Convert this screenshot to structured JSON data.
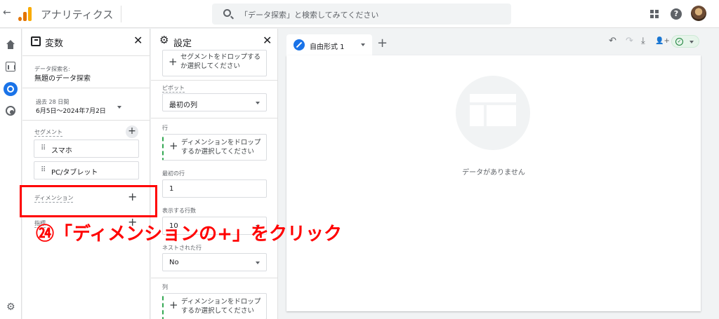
{
  "topbar": {
    "back_glyph": "←",
    "app_title": "アナリティクス",
    "search_placeholder": "「データ探索」と検索してみてください"
  },
  "colors": {
    "accent": "#1a73e8",
    "annotation": "#ff0000",
    "logo_orange": "#e37400",
    "logo_yellow": "#f9ab00",
    "dashed_green": "#34a853"
  },
  "icons": [
    "back-arrow-icon",
    "analytics-logo-icon",
    "search-icon",
    "apps-icon",
    "help-icon",
    "home-icon",
    "reports-icon",
    "explore-icon",
    "advertising-icon",
    "gear-icon",
    "variables-icon",
    "settings-icon",
    "close-icon",
    "pencil-icon",
    "undo-icon",
    "redo-icon",
    "download-icon",
    "share-icon",
    "check-icon"
  ],
  "variables": {
    "title": "変数",
    "close": "✕",
    "exploration_name_label": "データ探索名:",
    "exploration_name": "無題のデータ探索",
    "date_label": "過去 28 日間",
    "date_range": "6月5日～2024年7月2日",
    "segments_label": "セグメント",
    "segments": [
      "スマホ",
      "PC/タブレット"
    ],
    "dimensions_label": "ディメンション",
    "metrics_label": "指標",
    "plus": "+"
  },
  "settings": {
    "title": "設定",
    "close": "✕",
    "segment_drop_text": "セグメントをドロップするか選択してください",
    "pivot_label": "ピボット",
    "pivot_value": "最初の列",
    "rows_label": "行",
    "rows_drop_text": "ディメンションをドロップするか選択してください",
    "first_row_label": "最初の行",
    "first_row_value": "1",
    "rows_shown_label": "表示する行数",
    "rows_shown_value": "10",
    "nested_rows_label": "ネストされた行",
    "nested_rows_value": "No",
    "columns_label": "列",
    "columns_drop_text": "ディメンションをドロップするか選択してください",
    "plus": "+"
  },
  "canvas": {
    "tab_label": "自由形式 1",
    "add_tab": "+",
    "empty_message": "データがありません",
    "toolbar": {
      "undo": "↶",
      "redo": "↷",
      "download": "⤓",
      "share": "👤+",
      "check": "✓"
    }
  },
  "annotation": {
    "text": "㉔「ディメンションの+」をクリック"
  }
}
